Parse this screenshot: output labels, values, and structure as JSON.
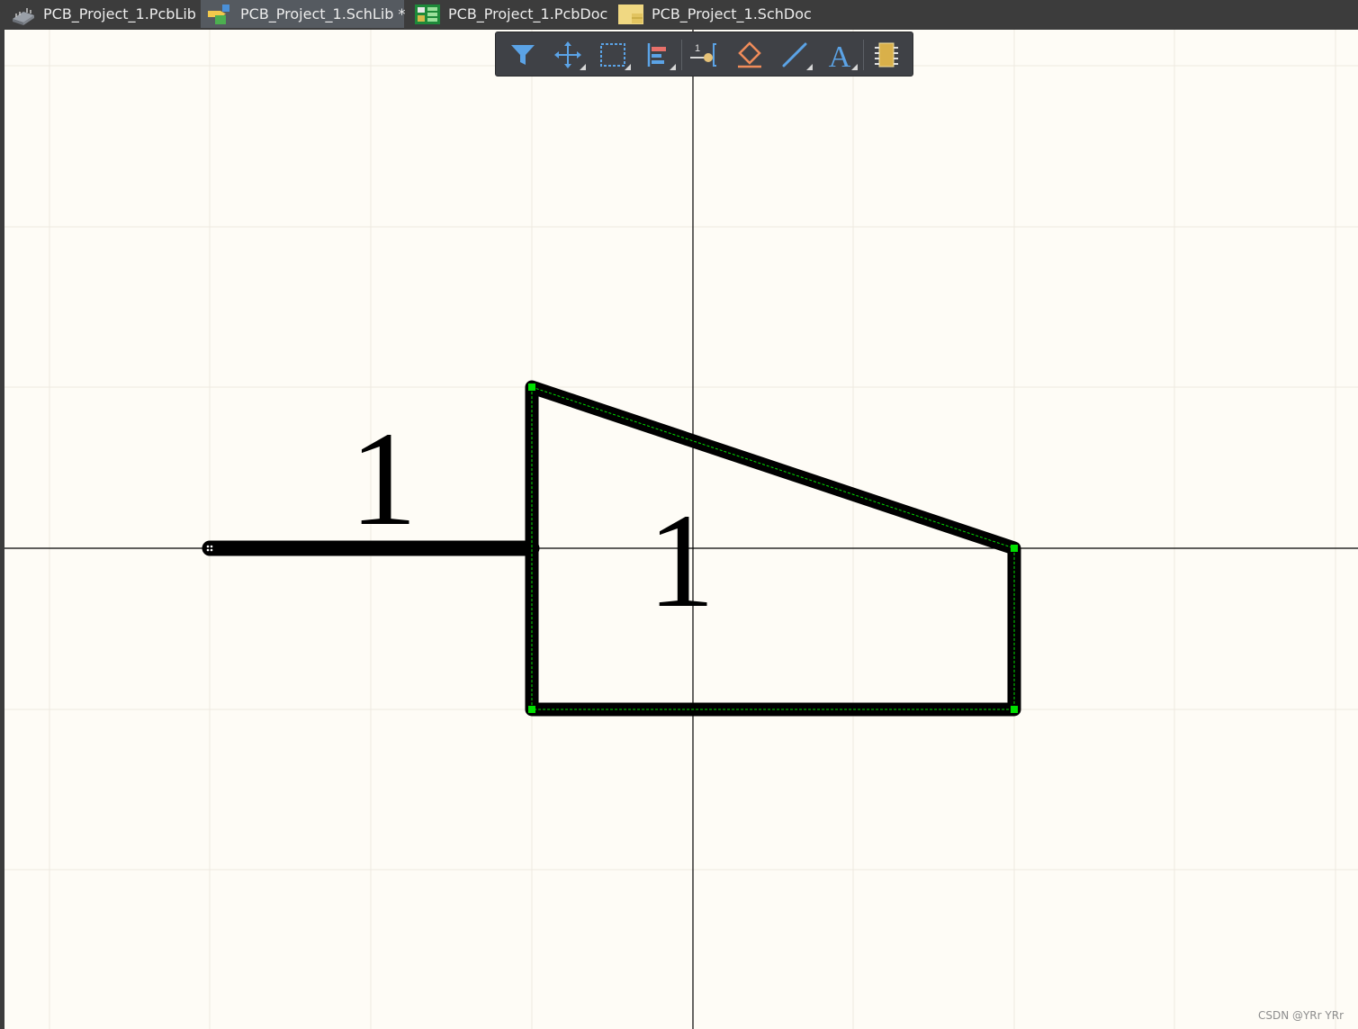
{
  "tabs": [
    {
      "label": "PCB_Project_1.PcbLib",
      "icon": "pcblib-icon",
      "active": false
    },
    {
      "label": "PCB_Project_1.SchLib *",
      "icon": "schlib-icon",
      "active": true
    },
    {
      "label": "PCB_Project_1.PcbDoc",
      "icon": "pcbdoc-icon",
      "active": false
    },
    {
      "label": "PCB_Project_1.SchDoc",
      "icon": "schdoc-icon",
      "active": false
    }
  ],
  "toolbar": {
    "tools": [
      {
        "name": "filter-icon",
        "has_dropdown": false
      },
      {
        "name": "move-icon",
        "has_dropdown": true
      },
      {
        "name": "select-rectangle-icon",
        "has_dropdown": true
      },
      {
        "name": "align-icon",
        "has_dropdown": true
      },
      {
        "name": "place-pin-icon",
        "has_dropdown": false
      },
      {
        "name": "place-ieee-symbol-icon",
        "has_dropdown": false
      },
      {
        "name": "place-line-icon",
        "has_dropdown": true
      },
      {
        "name": "place-text-icon",
        "has_dropdown": true
      },
      {
        "name": "add-component-part-icon",
        "has_dropdown": false
      }
    ],
    "pin_icon_label": "1",
    "text_icon_label": "A"
  },
  "schematic": {
    "pin_designator": "1",
    "shape_label": "1",
    "colors": {
      "background": "#fefcf6",
      "grid": "#eeeae0",
      "axis": "#000000",
      "shape": "#000000",
      "selection": "#00e000"
    }
  },
  "watermark": "CSDN @YRr YRr"
}
